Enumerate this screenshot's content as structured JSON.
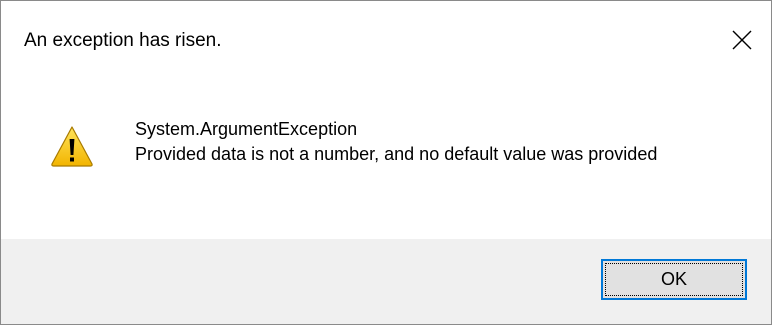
{
  "dialog": {
    "title": "An exception has risen.",
    "close_icon": "close-icon",
    "icon": "warning-icon",
    "message_lines": [
      "System.ArgumentException",
      "Provided data is not a number, and no default value was provided"
    ],
    "ok_label": "OK"
  },
  "colors": {
    "footer_background": "#f0f0f0",
    "button_border_focus": "#0078d7",
    "button_background": "#e1e1e1",
    "warning_yellow": "#f7c600"
  }
}
